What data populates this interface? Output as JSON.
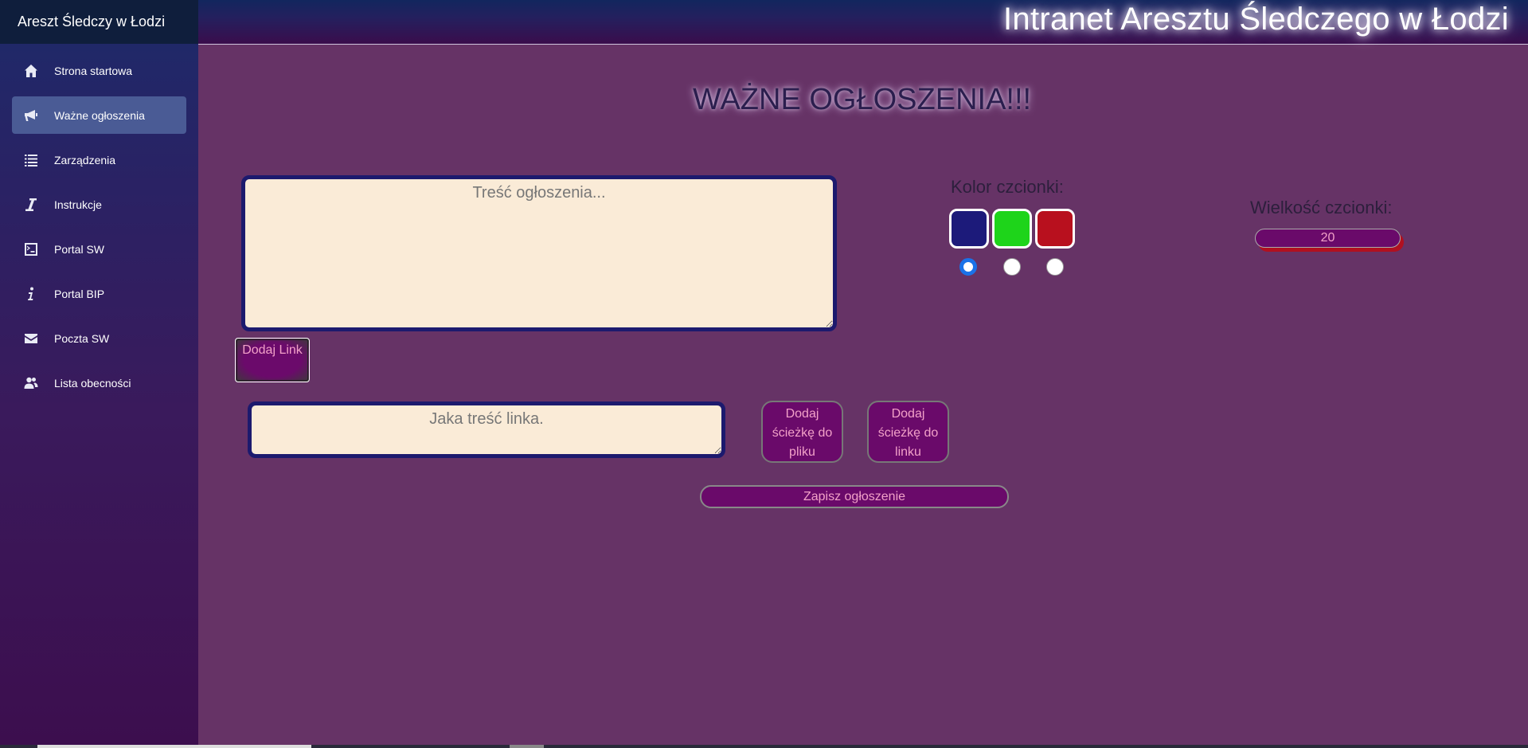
{
  "sidebar": {
    "brand": "Areszt Śledczy w Łodzi",
    "items": [
      {
        "label": "Strona startowa",
        "icon": "home-icon"
      },
      {
        "label": "Ważne ogłoszenia",
        "icon": "megaphone-icon",
        "active": true
      },
      {
        "label": "Zarządzenia",
        "icon": "list-icon"
      },
      {
        "label": "Instrukcje",
        "icon": "italic-i-icon"
      },
      {
        "label": "Portal SW",
        "icon": "terminal-icon"
      },
      {
        "label": "Portal BIP",
        "icon": "info-icon"
      },
      {
        "label": "Poczta SW",
        "icon": "envelope-icon"
      },
      {
        "label": "Lista obecności",
        "icon": "users-icon"
      }
    ]
  },
  "header": {
    "title": "Intranet Aresztu Śledczego w Łodzi"
  },
  "main": {
    "page_title": "WAŻNE OGŁOSZENIA!!!",
    "content_placeholder": "Treść ogłoszenia...",
    "add_link_label": "Dodaj Link",
    "link_text_placeholder": "Jaka treść linka.",
    "add_file_path_label": "Dodaj ścieżkę do pliku",
    "add_link_path_label": "Dodaj ścieżkę do linku",
    "save_label": "Zapisz ogłoszenie",
    "font_color": {
      "label": "Kolor czcionki:",
      "options": [
        {
          "name": "navy",
          "color": "#1c1a7a",
          "selected": true
        },
        {
          "name": "green",
          "color": "#1ed41a",
          "selected": false
        },
        {
          "name": "red",
          "color": "#b8101e",
          "selected": false
        }
      ]
    },
    "font_size": {
      "label": "Wielkość czcionki:",
      "value": "20"
    }
  }
}
